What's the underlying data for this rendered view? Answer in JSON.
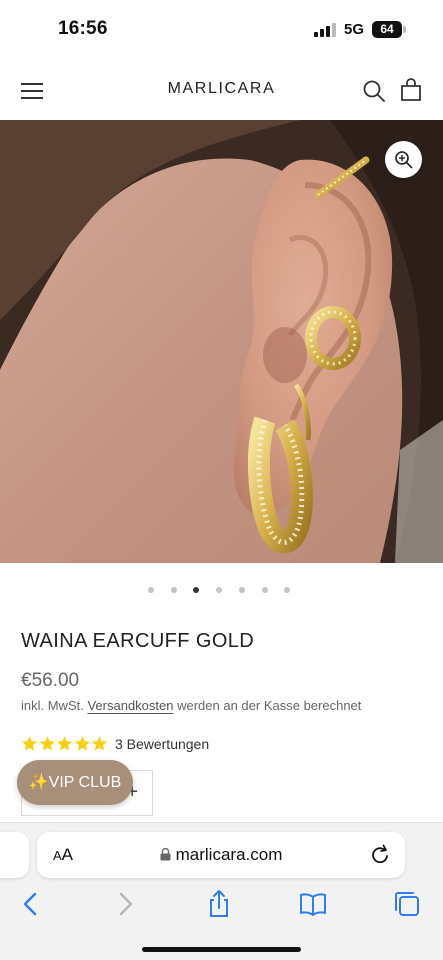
{
  "status_bar": {
    "time": "16:56",
    "network": "5G",
    "battery": "64"
  },
  "header": {
    "brand": "MARLICARA",
    "icons": [
      "menu-icon",
      "search-icon",
      "shopping-bag-icon"
    ]
  },
  "gallery": {
    "image_count": 7,
    "active_index": 2,
    "zoom_icon": "zoom-in-icon"
  },
  "product": {
    "title": "WAINA EARCUFF GOLD",
    "price": "€56.00",
    "tax_prefix": "inkl. MwSt.",
    "tax_link": "Versandkosten",
    "tax_suffix": "werden an der Kasse berechnet",
    "rating_stars": 5,
    "rating_count": "3 Bewertungen",
    "qty_plus": "+"
  },
  "vip": {
    "label": "✨VIP CLUB"
  },
  "browser": {
    "text_size_label_big": "A",
    "text_size_label_small": "A",
    "url": "marlicara.com",
    "toolbar": [
      "back-icon",
      "forward-icon",
      "share-icon",
      "bookmarks-icon",
      "tabs-icon"
    ]
  },
  "colors": {
    "vip_badge": "#a88f7a",
    "star": "#f6cf10",
    "accent_blue": "#2f7cf6"
  }
}
